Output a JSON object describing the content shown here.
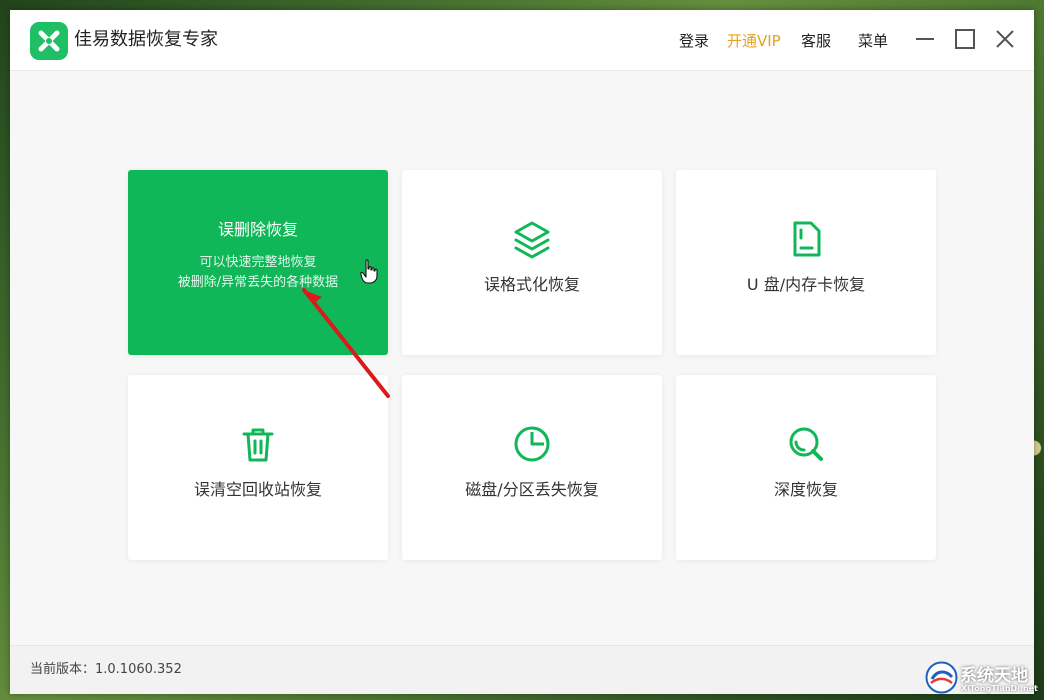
{
  "window": {
    "title": "佳易数据恢复专家"
  },
  "header": {
    "nav": {
      "login": "登录",
      "vip": "开通VIP",
      "service": "客服",
      "menu": "菜单"
    },
    "window_controls": {
      "minimize_icon": "minimize-icon",
      "maximize_icon": "maximize-icon",
      "close_icon": "close-icon"
    }
  },
  "main": {
    "cards": [
      {
        "title": "误删除恢复",
        "description_line1": "可以快速完整地恢复",
        "description_line2": "被删除/异常丢失的各种数据",
        "state": "hovered"
      },
      {
        "title": "误格式化恢复",
        "icon": "layers-icon"
      },
      {
        "title": "U 盘/内存卡恢复",
        "icon": "sd-card-icon"
      },
      {
        "title": "误清空回收站恢复",
        "icon": "trash-icon"
      },
      {
        "title": "磁盘/分区丢失恢复",
        "icon": "pie-chart-icon"
      },
      {
        "title": "深度恢复",
        "icon": "search-icon"
      }
    ]
  },
  "footer": {
    "version": "当前版本：1.0.1060.352"
  },
  "watermark": {
    "site_name": "系统天地",
    "site_url": "XiTongTianDi.net"
  },
  "colors": {
    "primary_green": "#10b759",
    "vip_gold": "#e7a21d",
    "annotation_red": "#d91b1b"
  }
}
